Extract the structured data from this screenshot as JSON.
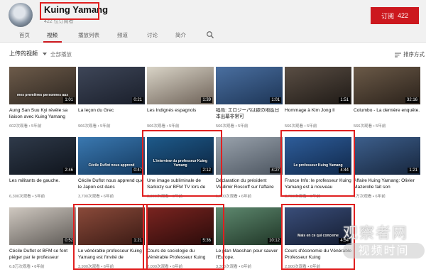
{
  "channel": {
    "name": "Kuing Yamang",
    "subscriber_text": "422 位订阅者"
  },
  "subscribe": {
    "label": "订阅",
    "count": "422"
  },
  "tabs": [
    {
      "label": "首页"
    },
    {
      "label": "视频"
    },
    {
      "label": "播放列表"
    },
    {
      "label": "频道"
    },
    {
      "label": "讨论"
    },
    {
      "label": "简介"
    }
  ],
  "active_tab": "视频",
  "section": {
    "title": "上传的视频",
    "play_all": "全部播放",
    "sort_label": "排序方式"
  },
  "videos": [
    {
      "title": "Aung San Suu Kyi révèle sa liaison avec Kuing Yamang",
      "meta": "602次观看 • 5年前",
      "duration": "1:01",
      "caption": "mes premières personnes aux",
      "colors": [
        "#6d5b4a",
        "#2d2620"
      ]
    },
    {
      "title": "La leçon du Grec",
      "meta": "966次观看 • 5年前",
      "duration": "0:21",
      "caption": "",
      "colors": [
        "#3e4658",
        "#1a1f2b"
      ]
    },
    {
      "title": "Les Indignés espagnols",
      "meta": "966次观看 • 5年前",
      "duration": "1:39",
      "caption": "",
      "colors": [
        "#d9d4c7",
        "#6e6258"
      ]
    },
    {
      "title": "福島: エロジーパは欲の地區日本出幕非常可",
      "meta": "566次观看 • 5年前",
      "duration": "1:01",
      "caption": "",
      "colors": [
        "#4a6fa0",
        "#1d3556"
      ]
    },
    {
      "title": "Hommage à Kim Jong Il",
      "meta": "566次观看 • 5年前",
      "duration": "1:51",
      "caption": "",
      "colors": [
        "#5a4e44",
        "#1f1a16"
      ]
    },
    {
      "title": "Columbo - La dernière enquête.",
      "meta": "566次观看 • 5年前",
      "duration": "32:16",
      "caption": "",
      "colors": [
        "#6b5a48",
        "#2a211a"
      ]
    },
    {
      "title": "Les militants de gauche.",
      "meta": "6,300次观看 • 5年前",
      "duration": "2:46",
      "caption": "",
      "colors": [
        "#2f3a4a",
        "#0f141c"
      ]
    },
    {
      "title": "Cécile Duflot nous apprend que le Japon est dans",
      "meta": "3,700次观看 • 6年前",
      "duration": "0:47",
      "caption": "Cécile Duflot nous apprend",
      "colors": [
        "#3a78b0",
        "#143a60"
      ]
    },
    {
      "title": "Une image subliminale de Sarkozy sur BFM TV lors de",
      "meta": "3,300次观看 • 6年前",
      "duration": "2:12",
      "caption": "L'interview du professeur Kuing Yamang",
      "colors": [
        "#1e5a8a",
        "#0b2440"
      ]
    },
    {
      "title": "Déclaration du président Vladimir Roscoff sur l'affaire",
      "meta": "1,700次观看 • 6年前",
      "duration": "4:27",
      "caption": "",
      "colors": [
        "#9aa3ad",
        "#4c5560"
      ]
    },
    {
      "title": "France Info: le professeur Kuing Yamang est à nouveau",
      "meta": "3,700次观看 • 6年前",
      "duration": "4:44",
      "caption": "Le professeur Kuing Yamang",
      "colors": [
        "#2e5d9a",
        "#10284a"
      ]
    },
    {
      "title": "Affaire Kuing Yamang: Olivier Mazerolle fait son",
      "meta": "1万次观看 • 6年前",
      "duration": "1:21",
      "caption": "",
      "colors": [
        "#3d5f8c",
        "#17263d"
      ]
    },
    {
      "title": "Cécile Duflot et BFM se font piéger par le professeur",
      "meta": "6.8万次观看 • 6年前",
      "duration": "0:52",
      "caption": "",
      "colors": [
        "#cfc8c0",
        "#5e5a56"
      ]
    },
    {
      "title": "Le vénérable professeur Kuing Yamang est l'invité de",
      "meta": "3,900次观看 • 6年前",
      "duration": "1:21",
      "caption": "",
      "colors": [
        "#8a4a3a",
        "#3a1a14"
      ]
    },
    {
      "title": "Cours de sociologie du Vénérable Professeur Kuing",
      "meta": "2,000次观看 • 6年前",
      "duration": "5:36",
      "caption": "",
      "colors": [
        "#7a2420",
        "#2a0b0a"
      ]
    },
    {
      "title": "Le plan Maoshan pour sauver l'Europe.",
      "meta": "3,300次观看 • 6年前",
      "duration": "10:12",
      "caption": "",
      "colors": [
        "#5f8a70",
        "#1f3526"
      ]
    },
    {
      "title": "Cours d'économie du Vénérable Professeur Kuing",
      "meta": "2,900次观看 • 6年前",
      "duration": "4:54",
      "caption": "Mais en ce qui concerne",
      "colors": [
        "#3a4e7a",
        "#141c30"
      ]
    }
  ],
  "watermark": {
    "top": "观察者网",
    "bottom": "视频时间"
  },
  "accent_colors": {
    "subscribe_red": "#cc181e",
    "highlight_red": "#e02020"
  }
}
